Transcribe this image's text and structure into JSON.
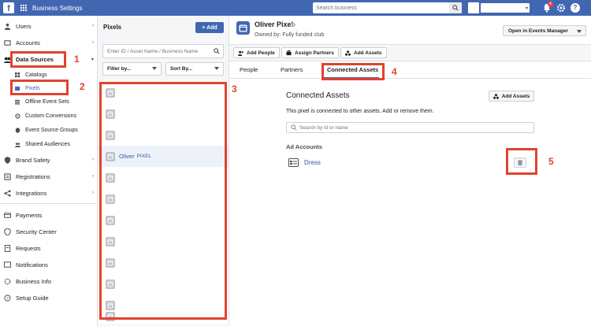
{
  "topbar": {
    "title": "Business Settings",
    "search_placeholder": "Search business",
    "notification_count": "4",
    "icons": [
      "facebook-logo",
      "apps-grid-icon",
      "search-icon",
      "bell-icon",
      "gear-icon",
      "help-icon"
    ]
  },
  "sidebar": {
    "items": [
      {
        "label": "Users",
        "icon": "user-icon",
        "chevron": "›"
      },
      {
        "label": "Accounts",
        "icon": "accounts-icon",
        "chevron": "›"
      },
      {
        "label": "Data Sources",
        "icon": "data-sources-icon",
        "chevron": "▾"
      },
      {
        "label": "Brand Safety",
        "icon": "shield-icon",
        "chevron": "›"
      },
      {
        "label": "Registrations",
        "icon": "registrations-icon",
        "chevron": "›"
      },
      {
        "label": "Integrations",
        "icon": "integrations-icon",
        "chevron": "›"
      },
      {
        "label": "Payments",
        "icon": "payments-icon"
      },
      {
        "label": "Security Center",
        "icon": "security-icon"
      },
      {
        "label": "Requests",
        "icon": "requests-icon"
      },
      {
        "label": "Notifications",
        "icon": "notifications-icon"
      },
      {
        "label": "Business Info",
        "icon": "business-info-icon"
      },
      {
        "label": "Setup Guide",
        "icon": "setup-guide-icon"
      }
    ],
    "sub_items": [
      {
        "label": "Catalogs"
      },
      {
        "label": "Pixels"
      },
      {
        "label": "Offline Event Sets"
      },
      {
        "label": "Custom Conversions"
      },
      {
        "label": "Event Source Groups"
      },
      {
        "label": "Shared Audiences"
      }
    ]
  },
  "pixels_panel": {
    "title": "Pixels",
    "add_label": "+ Add",
    "search_placeholder": "Enter ID / Asset Name / Business Name",
    "filter_label": "Filter by...",
    "sort_label": "Sort By...",
    "selected_name": "Oliver",
    "selected_tag": "PIXEL"
  },
  "main": {
    "pixel_name": "Oliver Pixel",
    "owner": "Owned by: Fully funded club",
    "open_events_manager": "Open in Events Manager",
    "actions": [
      "Add People",
      "Assign Partners",
      "Add Assets"
    ],
    "tabs": [
      "People",
      "Partners",
      "Connected Assets"
    ],
    "connected_title": "Connected Assets",
    "add_assets_label": "Add Assets",
    "description": "This pixel is connected to other assets. Add or remove them.",
    "search_placeholder": "Search by id or name",
    "ad_accounts_label": "Ad Accounts",
    "account_name": "Dress"
  },
  "annotations": [
    "1",
    "2",
    "3",
    "4",
    "5"
  ],
  "colors": {
    "brand": "#4267b2",
    "highlight": "#e0432f",
    "link": "#365899"
  }
}
